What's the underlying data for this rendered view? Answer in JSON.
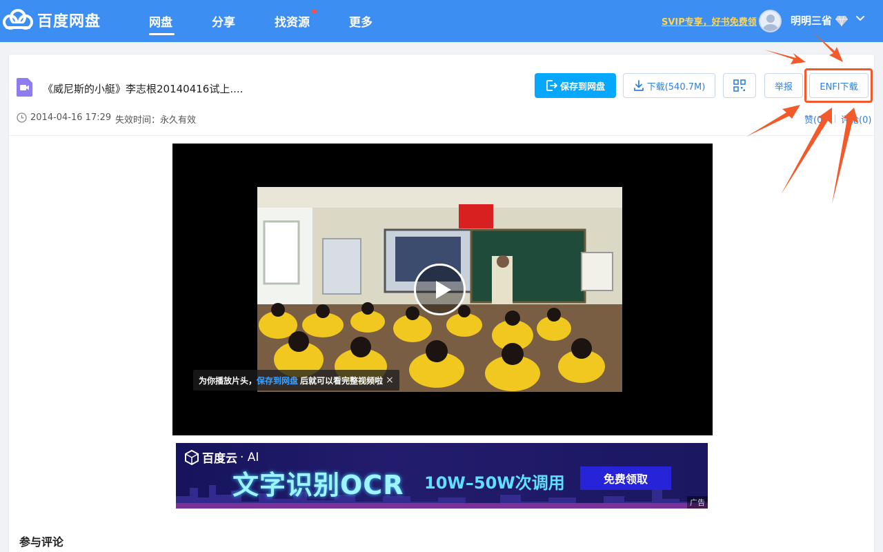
{
  "header": {
    "logo_text": "百度网盘",
    "nav": [
      {
        "label": "网盘",
        "active": true
      },
      {
        "label": "分享",
        "active": false
      },
      {
        "label": "找资源",
        "active": false,
        "has_dot": true
      },
      {
        "label": "更多",
        "active": false
      }
    ],
    "svip_promo": "SVIP专享，好书免费领",
    "username": "明明三省"
  },
  "file": {
    "title": "《威尼斯的小艇》李志根20140416试上....",
    "date": "2014-04-16 17:29",
    "expire": "失效时间：永久有效"
  },
  "actions": {
    "save_label": "保存到网盘",
    "download_label": "下载(540.7M)",
    "report_label": "举报",
    "enfi_label": "ENFI下载",
    "like_label": "赞(0)",
    "comment_label": "评论(0)"
  },
  "video": {
    "tip_prefix": "为你播放片头，",
    "tip_link": "保存到网盘",
    "tip_suffix": "后就可以看完整视频啦",
    "close_symbol": "×"
  },
  "ad": {
    "brand": "百度云",
    "brand_suffix": "· AI",
    "title": "文字识别OCR",
    "subtitle": "10W–50W次调用",
    "cta": "免费领取",
    "tag": "广告"
  },
  "comments": {
    "section_title": "参与评论"
  },
  "colors": {
    "topbar": "#3d8ef2",
    "primary_button": "#06a7ff",
    "link": "#2f7fe0",
    "annotation": "#f25a2b"
  },
  "icons": [
    "baidu-cloud-logo-icon",
    "vip-diamond-icon",
    "chevron-down-icon",
    "video-file-icon",
    "clock-icon",
    "save-to-disk-icon",
    "download-icon",
    "qr-code-icon",
    "play-icon",
    "close-icon"
  ]
}
